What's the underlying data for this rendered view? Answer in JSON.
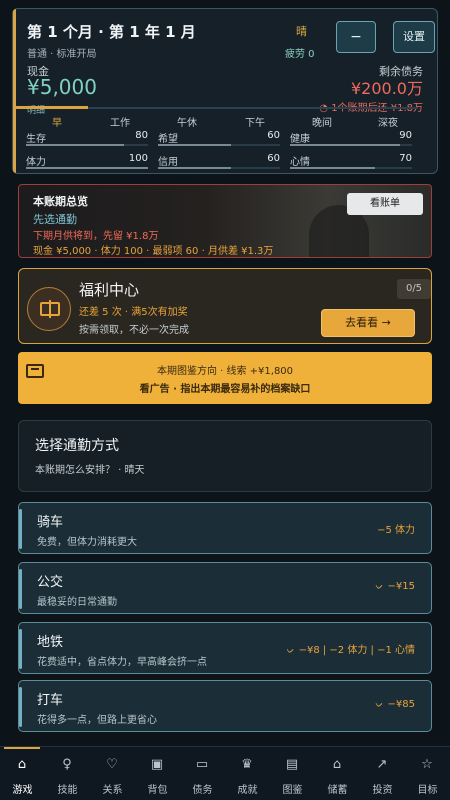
{
  "header": {
    "title": "第 1 个月 · 第 1 年 1 月",
    "weather": "晴",
    "minus_label": "−",
    "settings_label": "设置",
    "mode": "普通 · 标准开局",
    "fatigue": "疲劳 0",
    "cash_label": "现金",
    "cash_value": "¥5,000",
    "detail_label": "明细",
    "debt_label": "剩余债务",
    "debt_value": "¥200.0万",
    "debt_next": "1个账期后还 ¥1.8万"
  },
  "periods": [
    "早",
    "工作",
    "午休",
    "下午",
    "晚间",
    "深夜"
  ],
  "stats": [
    {
      "label": "生存",
      "value": "80",
      "fraction": 0.8
    },
    {
      "label": "希望",
      "value": "60",
      "fraction": 0.6
    },
    {
      "label": "健康",
      "value": "90",
      "fraction": 0.9
    },
    {
      "label": "体力",
      "value": "100",
      "fraction": 1.0
    },
    {
      "label": "信用",
      "value": "60",
      "fraction": 0.6
    },
    {
      "label": "心情",
      "value": "70",
      "fraction": 0.7
    }
  ],
  "overview": {
    "title": "本账期总览",
    "button": "看账单",
    "subtitle": "先选通勤",
    "warning": "下期月供将到，先留 ¥1.8万",
    "stats": "现金 ¥5,000 · 体力 100 · 最弱项 60 · 月供差 ¥1.3万"
  },
  "welfare": {
    "title": "福利中心",
    "count": "0/5",
    "line1": "还差 5 次 · 满5次有加奖",
    "line2": "按需领取，不必一次完成",
    "button": "去看看 →"
  },
  "ad": {
    "line1": "本期图鉴方向 · 线索 +¥1,800",
    "line2": "看广告 · 指出本期最容易补的档案缺口"
  },
  "choose": {
    "title": "选择通勤方式",
    "subtitle": "本账期怎么安排？ · 晴天"
  },
  "options": [
    {
      "name": "骑车",
      "desc": "免费，但体力消耗更大",
      "cost": "−5 体力",
      "icon": ""
    },
    {
      "name": "公交",
      "desc": "最稳妥的日常通勤",
      "cost": "−¥15",
      "icon": "ᨆ"
    },
    {
      "name": "地铁",
      "desc": "花费适中，省点体力，早高峰会挤一点",
      "cost": "−¥8 | −2 体力 | −1 心情",
      "icon": "ᨆ"
    },
    {
      "name": "打车",
      "desc": "花得多一点，但路上更省心",
      "cost": "−¥85",
      "icon": "ᨆ"
    }
  ],
  "nav": [
    {
      "label": "游戏",
      "icon": "⌂"
    },
    {
      "label": "技能",
      "icon": "♀"
    },
    {
      "label": "关系",
      "icon": "♡"
    },
    {
      "label": "背包",
      "icon": "▣"
    },
    {
      "label": "债务",
      "icon": "▭"
    },
    {
      "label": "成就",
      "icon": "♛"
    },
    {
      "label": "图鉴",
      "icon": "▤"
    },
    {
      "label": "储蓄",
      "icon": "⌂"
    },
    {
      "label": "投资",
      "icon": "↗"
    },
    {
      "label": "目标",
      "icon": "☆"
    }
  ],
  "colors": {
    "accent": "#d9a441",
    "cash": "#7fd1c2",
    "debt": "#f06a5c",
    "banner": "#f0b13b"
  }
}
